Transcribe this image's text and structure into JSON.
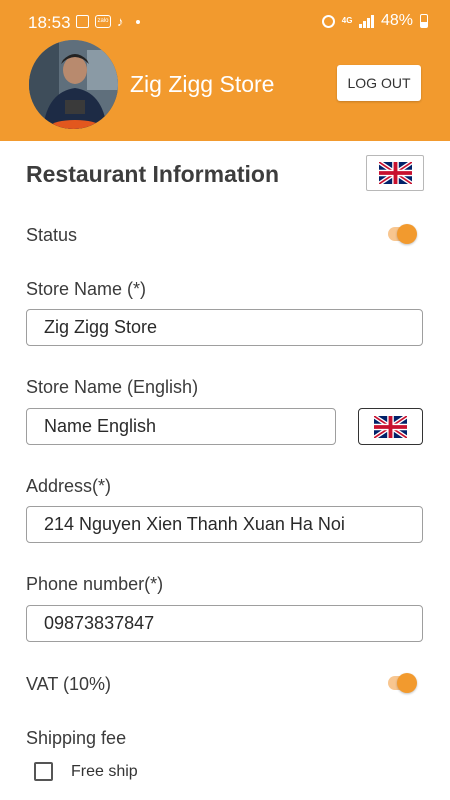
{
  "statusbar": {
    "time": "18:53",
    "network": "4G",
    "battery": "48%",
    "icons": [
      "gallery-icon",
      "zalo-icon",
      "tiktok-icon",
      "dot-icon",
      "alarm-icon",
      "signal-icon",
      "battery-icon"
    ]
  },
  "header": {
    "store_name": "Zig Zigg Store",
    "logout_label": "LOG OUT",
    "background_color": "#F29A2E"
  },
  "section": {
    "title": "Restaurant Information",
    "language_flag": "uk-flag-icon"
  },
  "fields": {
    "status_label": "Status",
    "status_on": true,
    "store_name_label": "Store Name (*)",
    "store_name_value": "Zig Zigg Store",
    "store_name_en_label": "Store Name (English)",
    "store_name_en_value": "Name English",
    "address_label": "Address(*)",
    "address_value": "214 Nguyen Xien Thanh Xuan Ha Noi",
    "phone_label": "Phone number(*)",
    "phone_value": "09873837847",
    "vat_label": "VAT (10%)",
    "vat_on": true,
    "shipping_label": "Shipping fee",
    "free_ship_label": "Free ship",
    "free_ship_checked": false
  },
  "colors": {
    "accent": "#F29A2E",
    "toggle_track": "#F8C690"
  }
}
